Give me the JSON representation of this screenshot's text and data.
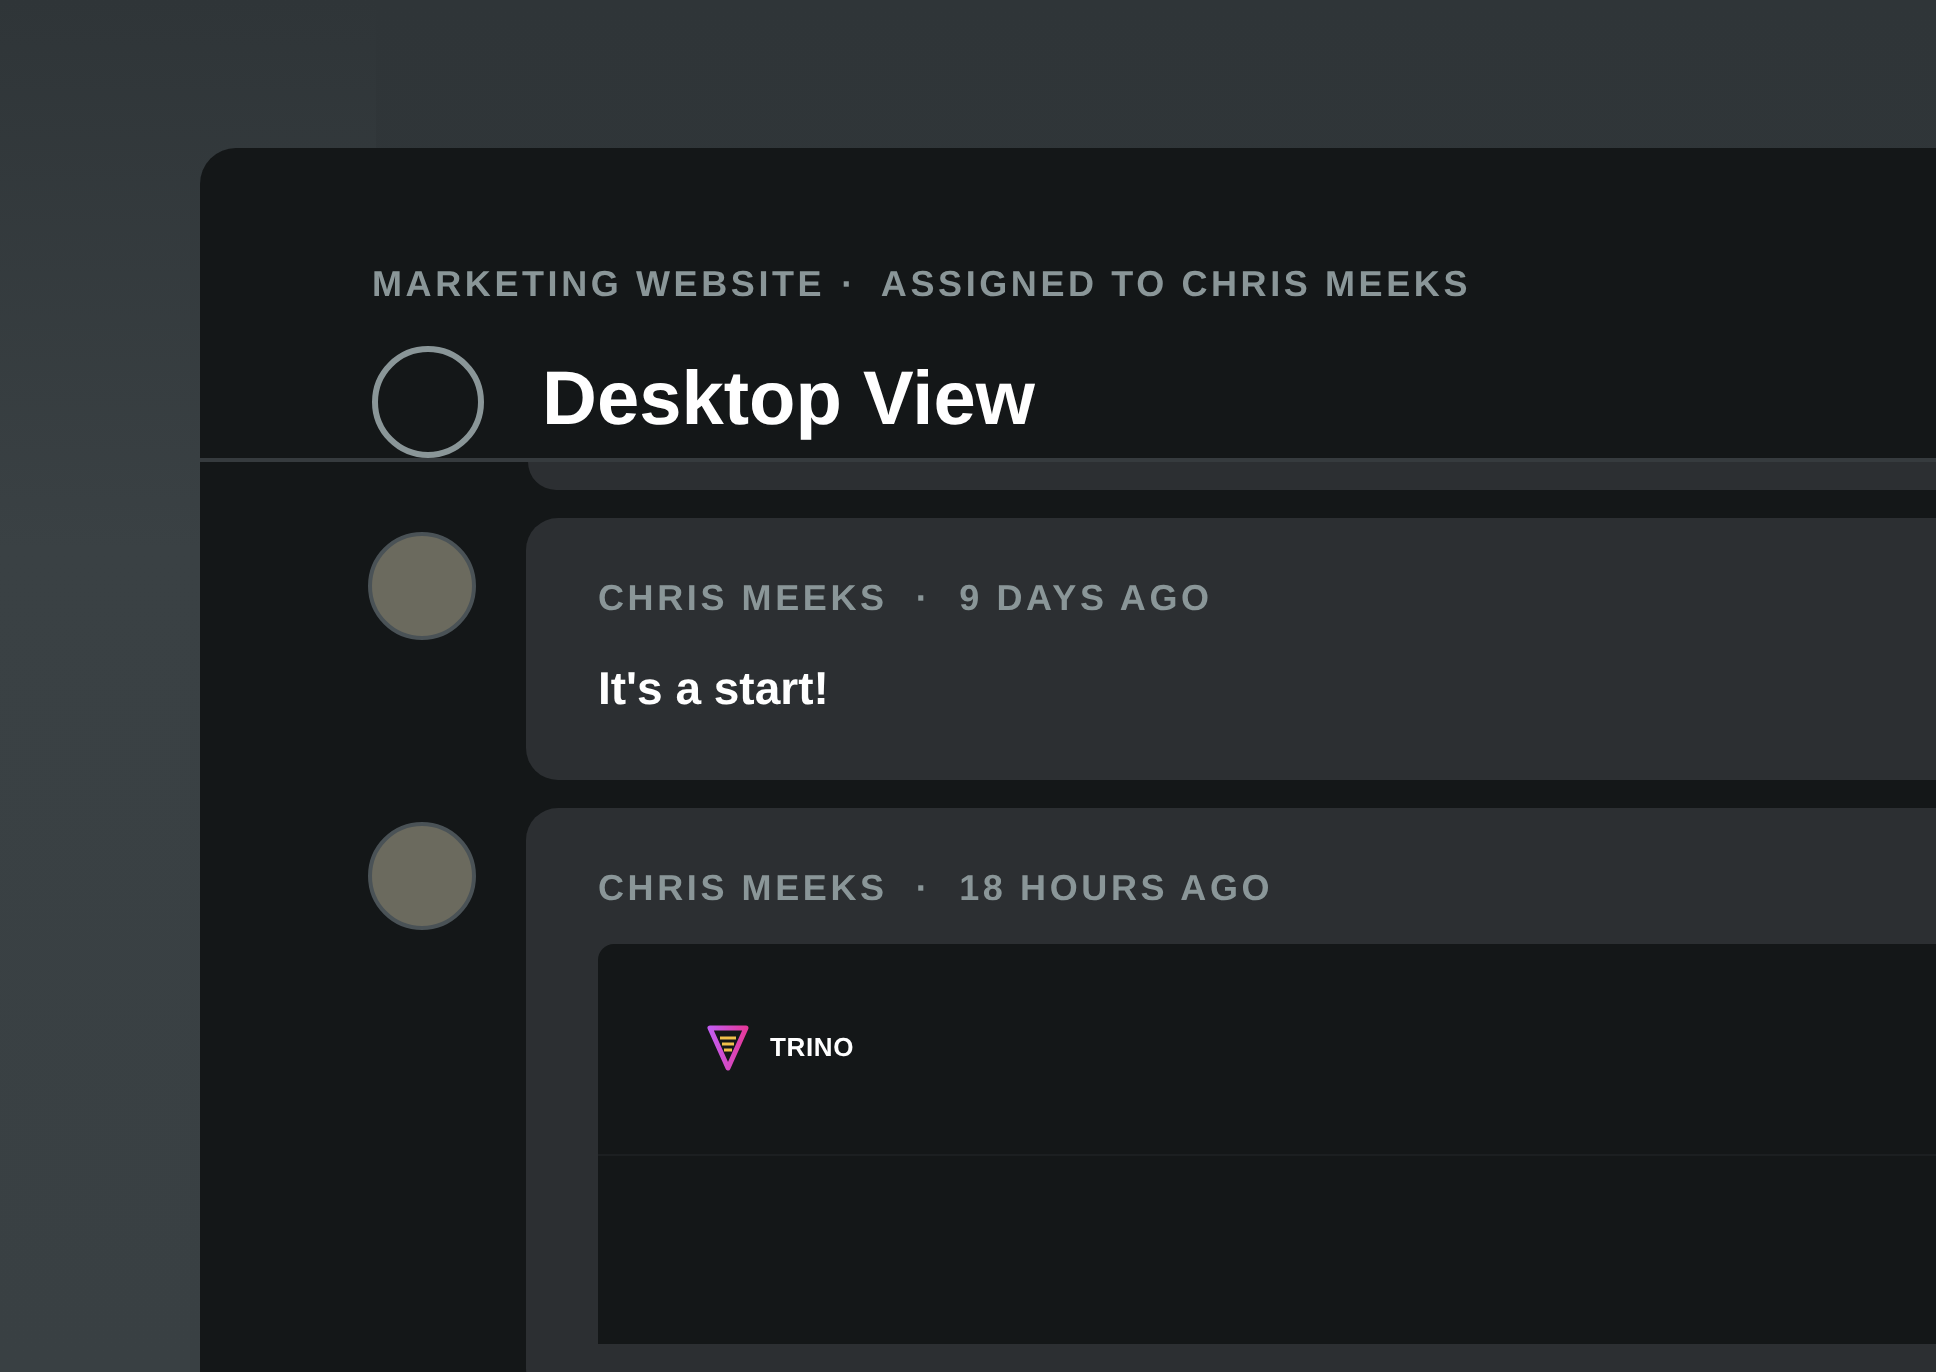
{
  "breadcrumb": {
    "project": "MARKETING WEBSITE",
    "separator": "·",
    "assignee": "ASSIGNED TO CHRIS MEEKS"
  },
  "task": {
    "title": "Desktop View",
    "completed": false
  },
  "comments": [
    {
      "kind": "text",
      "author": "CHRIS MEEKS",
      "separator": "·",
      "time": "9 DAYS AGO",
      "body": "It's a start!"
    },
    {
      "kind": "image",
      "author": "CHRIS MEEKS",
      "separator": "·",
      "time": "18 HOURS AGO",
      "preview": {
        "logo_text": "TRINO"
      }
    }
  ]
}
